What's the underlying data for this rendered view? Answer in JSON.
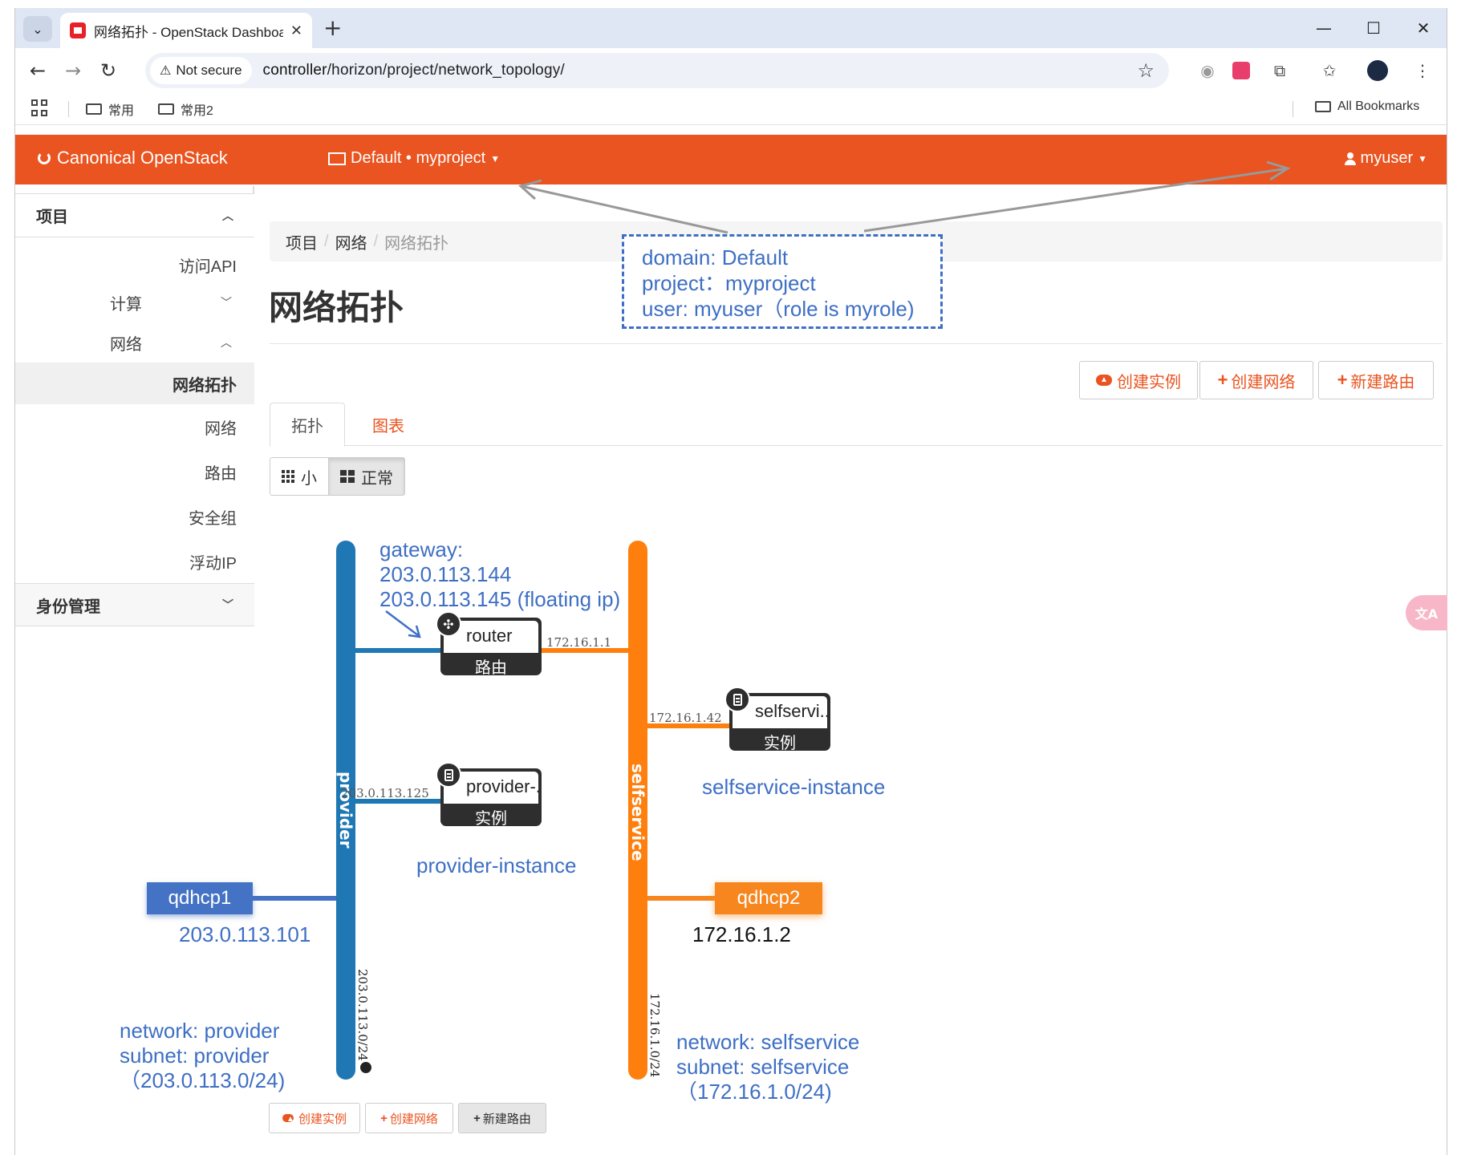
{
  "browser": {
    "tab_title": "网络拓扑 - OpenStack Dashboard",
    "new_tab": "+",
    "security_label": "Not secure",
    "url_host": "controller",
    "url_path": "/horizon/project/network_topology/",
    "bookmarks": [
      "常用",
      "常用2"
    ],
    "all_bookmarks": "All Bookmarks"
  },
  "navbar": {
    "brand": "Canonical OpenStack",
    "project_selector": "Default • myproject",
    "user": "myuser",
    "color": "#e95420"
  },
  "sidebar": {
    "project_header": "项目",
    "items": [
      {
        "label": "访问API"
      },
      {
        "label": "计算"
      },
      {
        "label": "网络"
      },
      {
        "label": "网络拓扑"
      },
      {
        "label": "网络"
      },
      {
        "label": "路由"
      },
      {
        "label": "安全组"
      },
      {
        "label": "浮动IP"
      }
    ],
    "identity_header": "身份管理"
  },
  "breadcrumb": [
    "项目",
    "网络",
    "网络拓扑"
  ],
  "page_title": "网络拓扑",
  "actions": {
    "create_instance": "创建实例",
    "create_network": "创建网络",
    "create_router": "新建路由"
  },
  "tabs": {
    "topology": "拓扑",
    "graph": "图表"
  },
  "size_toggle": {
    "small": "小",
    "normal": "正常"
  },
  "topology": {
    "networks": [
      {
        "name": "provider",
        "cidr": "203.0.113.0/24",
        "color": "#1f77b4"
      },
      {
        "name": "selfservice",
        "cidr": "172.16.1.0/24",
        "color": "#ff7f0e"
      }
    ],
    "router": {
      "name": "router",
      "type": "路由",
      "selfservice_ip": "172.16.1.1"
    },
    "instances": [
      {
        "name": "selfservi..",
        "type": "实例",
        "ip": "172.16.1.42"
      },
      {
        "name": "provider-..",
        "type": "实例",
        "ip": "203.0.113.125"
      }
    ]
  },
  "annotations": {
    "domain": "domain: Default",
    "project": "project：myproject",
    "user": "user: myuser（role is myrole)",
    "gateway_title": "gateway:",
    "gateway_ip": "203.0.113.144",
    "floating_ip": "203.0.113.145 (floating ip)",
    "selfservice_instance": "selfservice-instance",
    "provider_instance": "provider-instance",
    "qdhcp1": "qdhcp1",
    "qdhcp1_ip": "203.0.113.101",
    "qdhcp2": "qdhcp2",
    "qdhcp2_ip": "172.16.1.2",
    "provider_net": "network: provider",
    "provider_subnet": "subnet: provider",
    "provider_cidr": "（203.0.113.0/24)",
    "self_net": "network: selfservice",
    "self_subnet": "subnet: selfservice",
    "self_cidr": "（172.16.1.0/24)",
    "color": "#3e6fc4"
  }
}
